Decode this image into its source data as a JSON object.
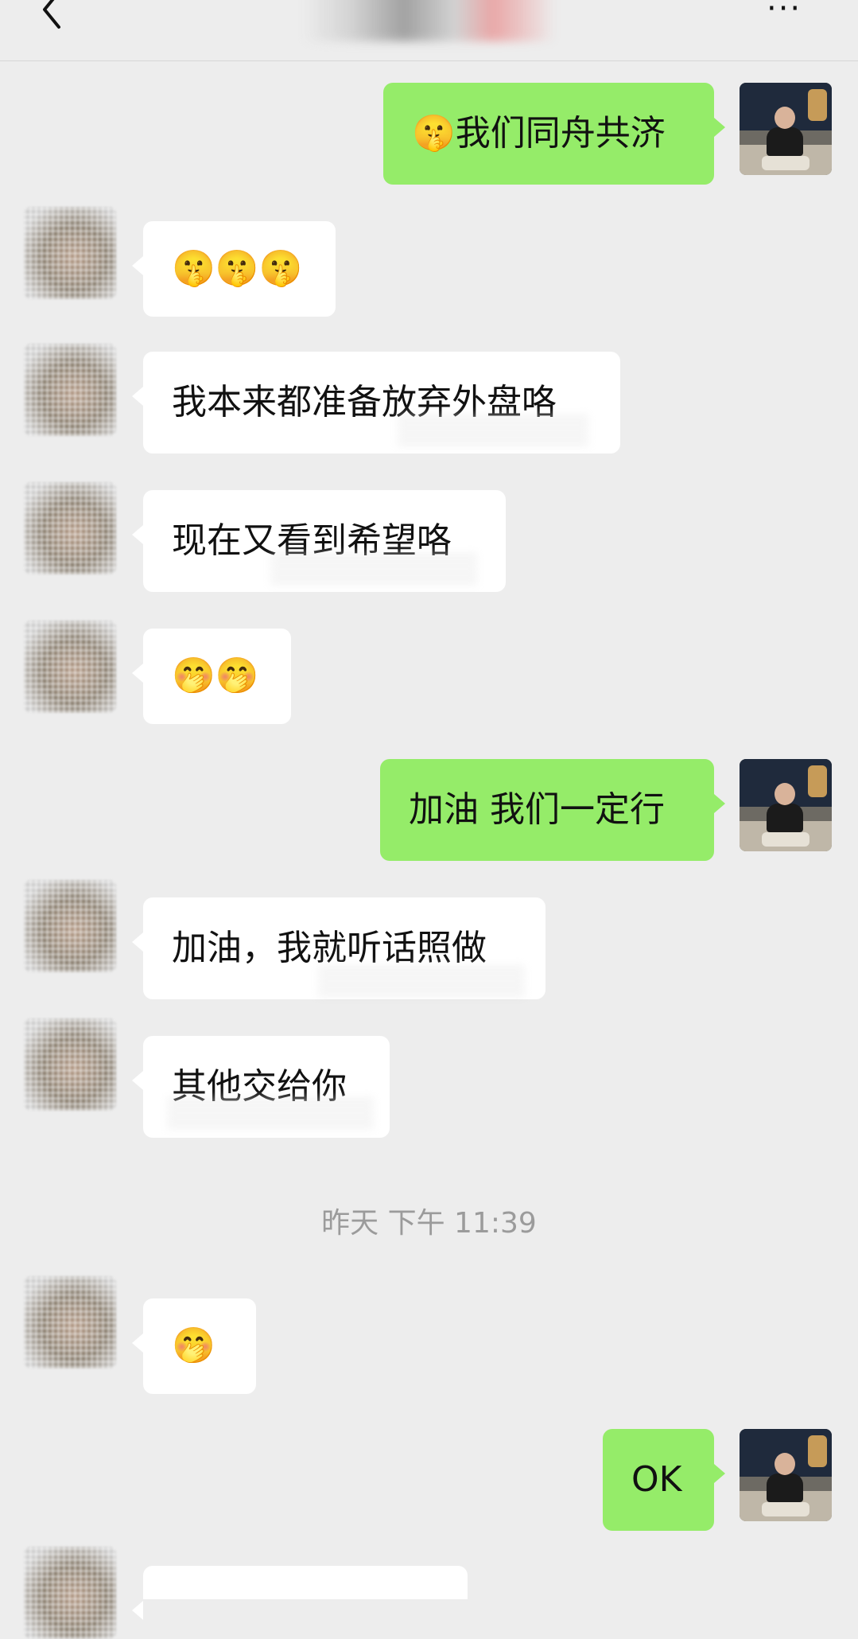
{
  "header": {
    "more_label": "···"
  },
  "messages": [
    {
      "side": "out",
      "text": "🤫我们同舟共济",
      "sender": "me"
    },
    {
      "side": "in",
      "text": "🤫🤫🤫",
      "sender": "contact"
    },
    {
      "side": "in",
      "text": "我本来都准备放弃外盘咯",
      "sender": "contact"
    },
    {
      "side": "in",
      "text": "现在又看到希望咯",
      "sender": "contact"
    },
    {
      "side": "in",
      "text": "🤭🤭",
      "sender": "contact"
    },
    {
      "side": "out",
      "text": "加油 我们一定行",
      "sender": "me"
    },
    {
      "side": "in",
      "text": "加油，我就听话照做",
      "sender": "contact"
    },
    {
      "side": "in",
      "text": "其他交给你",
      "sender": "contact"
    },
    {
      "side": "in",
      "text": "🤭",
      "sender": "contact"
    },
    {
      "side": "out",
      "text": "OK",
      "sender": "me"
    },
    {
      "side": "in",
      "text": "",
      "sender": "contact"
    }
  ],
  "timestamp": "昨天 下午 11:39",
  "colors": {
    "background": "#ededed",
    "outgoing_bubble": "#95ec69",
    "incoming_bubble": "#ffffff",
    "timestamp_text": "#9b9b9b"
  }
}
